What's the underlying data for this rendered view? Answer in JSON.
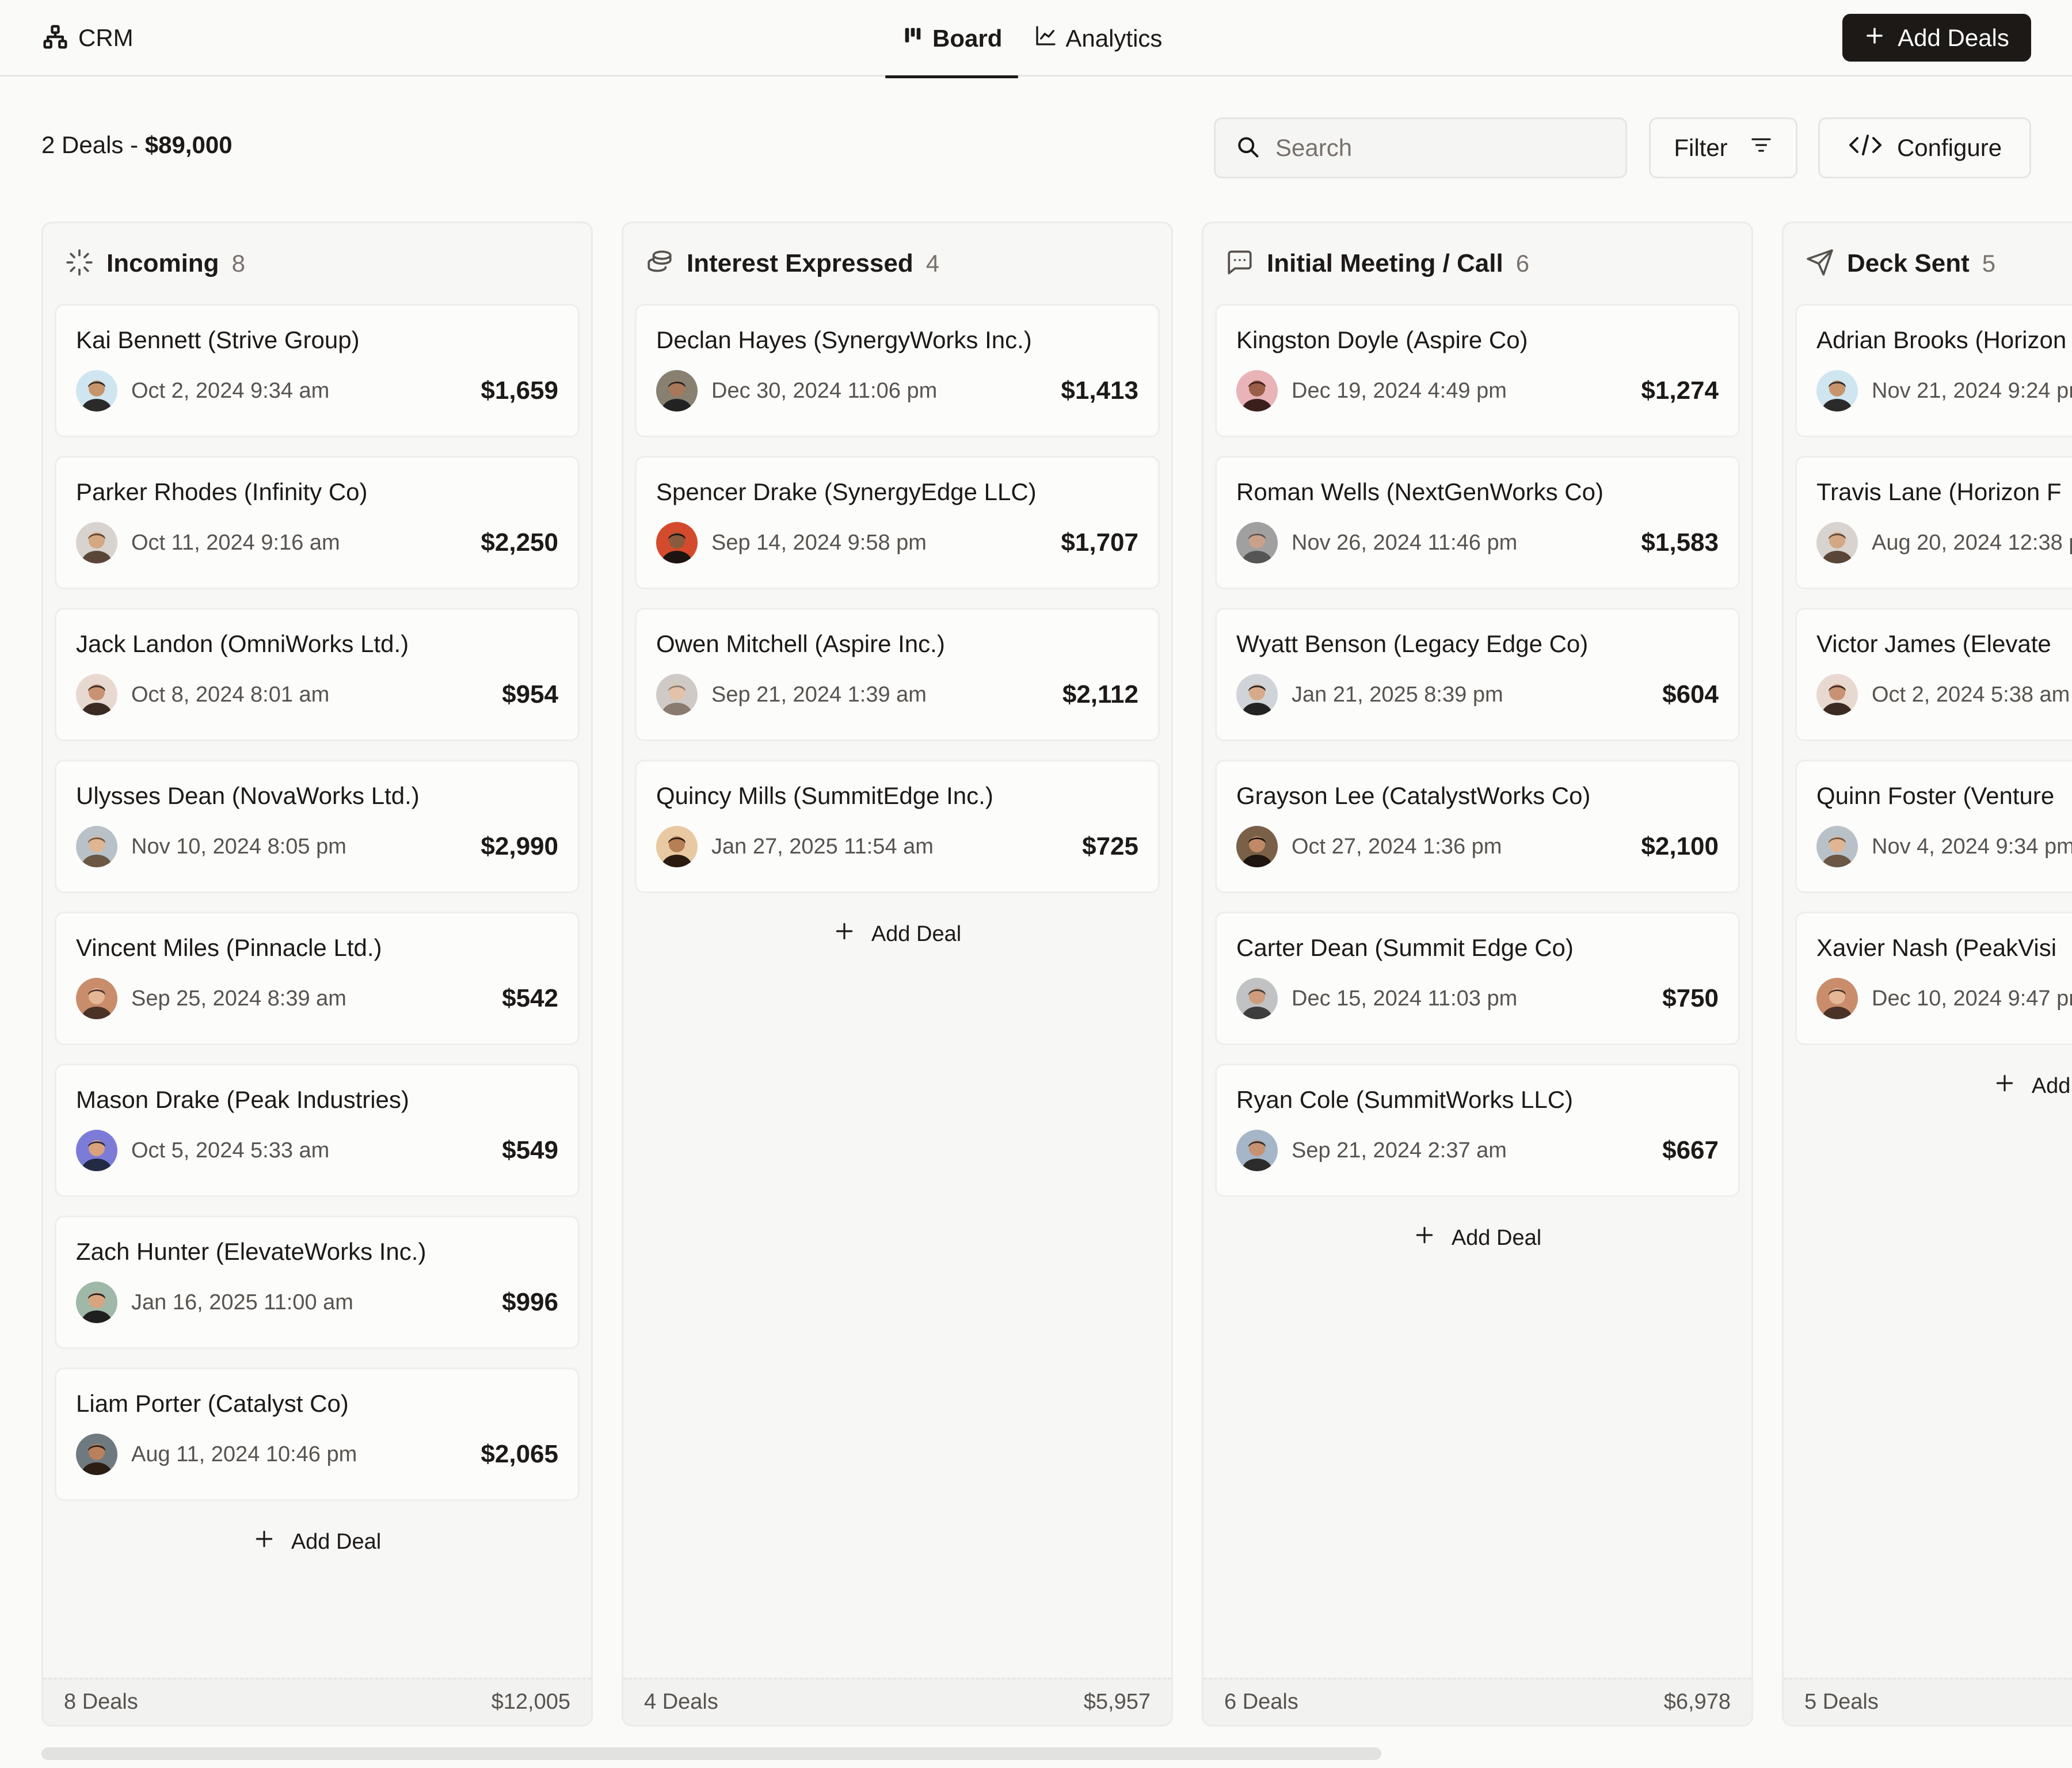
{
  "app": {
    "name": "CRM"
  },
  "header": {
    "tabs": [
      {
        "label": "Board",
        "icon": "kanban-icon",
        "active": true
      },
      {
        "label": "Analytics",
        "icon": "line-chart-icon",
        "active": false
      }
    ],
    "add_button_label": "Add Deals"
  },
  "summary": {
    "count_text": "2 Deals -",
    "total": "$89,000"
  },
  "toolbar": {
    "search_placeholder": "Search",
    "filter_label": "Filter",
    "configure_label": "Configure"
  },
  "colors": {
    "primary": "#1c1917",
    "muted": "#78716c",
    "border": "#e7e5e4",
    "background": "#fafaf9"
  },
  "add_deal_label": "Add Deal",
  "columns": [
    {
      "title": "Incoming",
      "count": "8",
      "icon": "loader-icon",
      "footer_count": "8 Deals",
      "footer_total": "$12,005",
      "deals": [
        {
          "name": "Kai Bennett (Strive Group)",
          "date": "Oct 2, 2024 9:34 am",
          "amount": "$1,659"
        },
        {
          "name": "Parker Rhodes (Infinity Co)",
          "date": "Oct 11, 2024 9:16 am",
          "amount": "$2,250"
        },
        {
          "name": "Jack Landon (OmniWorks Ltd.)",
          "date": "Oct 8, 2024 8:01 am",
          "amount": "$954"
        },
        {
          "name": "Ulysses Dean (NovaWorks Ltd.)",
          "date": "Nov 10, 2024 8:05 pm",
          "amount": "$2,990"
        },
        {
          "name": "Vincent Miles (Pinnacle Ltd.)",
          "date": "Sep 25, 2024 8:39 am",
          "amount": "$542"
        },
        {
          "name": "Mason Drake (Peak Industries)",
          "date": "Oct 5, 2024 5:33 am",
          "amount": "$549"
        },
        {
          "name": "Zach Hunter (ElevateWorks Inc.)",
          "date": "Jan 16, 2025 11:00 am",
          "amount": "$996"
        },
        {
          "name": "Liam Porter (Catalyst Co)",
          "date": "Aug 11, 2024 10:46 pm",
          "amount": "$2,065"
        }
      ]
    },
    {
      "title": "Interest Expressed",
      "count": "4",
      "icon": "coins-icon",
      "footer_count": "4 Deals",
      "footer_total": "$5,957",
      "deals": [
        {
          "name": "Declan Hayes (SynergyWorks Inc.)",
          "date": "Dec 30, 2024 11:06 pm",
          "amount": "$1,413"
        },
        {
          "name": "Spencer Drake (SynergyEdge LLC)",
          "date": "Sep 14, 2024 9:58 pm",
          "amount": "$1,707"
        },
        {
          "name": "Owen Mitchell (Aspire Inc.)",
          "date": "Sep 21, 2024 1:39 am",
          "amount": "$2,112"
        },
        {
          "name": "Quincy Mills (SummitEdge Inc.)",
          "date": "Jan 27, 2025 11:54 am",
          "amount": "$725"
        }
      ]
    },
    {
      "title": "Initial Meeting / Call",
      "count": "6",
      "icon": "message-square-icon",
      "footer_count": "6 Deals",
      "footer_total": "$6,978",
      "deals": [
        {
          "name": "Kingston Doyle (Aspire Co)",
          "date": "Dec 19, 2024 4:49 pm",
          "amount": "$1,274"
        },
        {
          "name": "Roman Wells (NextGenWorks Co)",
          "date": "Nov 26, 2024 11:46 pm",
          "amount": "$1,583"
        },
        {
          "name": "Wyatt Benson (Legacy Edge Co)",
          "date": "Jan 21, 2025 8:39 pm",
          "amount": "$604"
        },
        {
          "name": "Grayson Lee (CatalystWorks Co)",
          "date": "Oct 27, 2024 1:36 pm",
          "amount": "$2,100"
        },
        {
          "name": "Carter Dean (Summit Edge Co)",
          "date": "Dec 15, 2024 11:03 pm",
          "amount": "$750"
        },
        {
          "name": "Ryan Cole (SummitWorks LLC)",
          "date": "Sep 21, 2024 2:37 am",
          "amount": "$667"
        }
      ]
    },
    {
      "title": "Deck Sent",
      "count": "5",
      "icon": "send-icon",
      "footer_count": "5 Deals",
      "footer_total": "",
      "deals": [
        {
          "name": "Adrian Brooks (Horizon",
          "date": "Nov 21, 2024 9:24 pm",
          "amount": ""
        },
        {
          "name": "Travis Lane (Horizon F",
          "date": "Aug 20, 2024 12:38 p",
          "amount": ""
        },
        {
          "name": "Victor James (Elevate",
          "date": "Oct 2, 2024 5:38 am",
          "amount": ""
        },
        {
          "name": "Quinn Foster (Venture",
          "date": "Nov 4, 2024 9:34 pm",
          "amount": ""
        },
        {
          "name": "Xavier Nash (PeakVisi",
          "date": "Dec 10, 2024 9:47 pm",
          "amount": ""
        }
      ]
    }
  ]
}
